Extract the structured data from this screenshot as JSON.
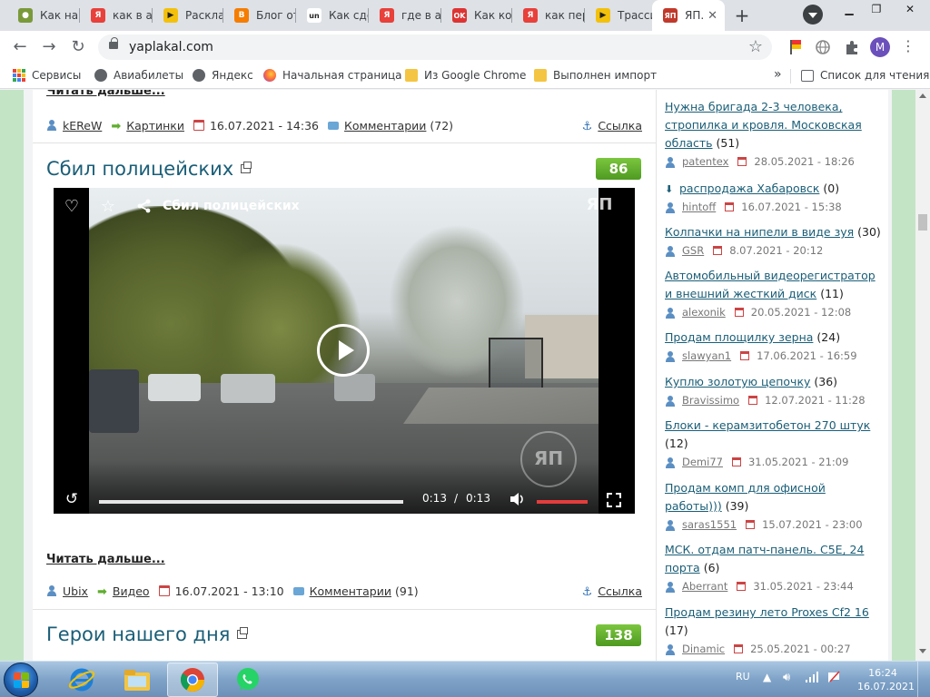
{
  "browser": {
    "tabs": [
      {
        "label": "Как на",
        "icon": "site-icon",
        "color": "#7a9a3a"
      },
      {
        "label": "как в а",
        "icon": "yandex-icon",
        "color": "#e8403a"
      },
      {
        "label": "Раскла",
        "icon": "play-icon",
        "color": "#f3c10c"
      },
      {
        "label": "Блог от",
        "icon": "blogger-icon",
        "color": "#f57d00"
      },
      {
        "label": "Как сде",
        "icon": "site-un-icon",
        "color": "#222222"
      },
      {
        "label": "где в а",
        "icon": "yandex-icon",
        "color": "#e8403a"
      },
      {
        "label": "Как ко",
        "icon": "ok-icon",
        "color": "#d33"
      },
      {
        "label": "как пер",
        "icon": "yandex-icon",
        "color": "#e8403a"
      },
      {
        "label": "Трасси",
        "icon": "play-icon",
        "color": "#f3c10c"
      },
      {
        "label": "ЯП.",
        "icon": "yaplakal-icon",
        "color": "#c0392b"
      }
    ],
    "url": "yaplakal.com",
    "avatar_letter": "M",
    "bookmarks": [
      {
        "label": "Сервисы",
        "icon": "apps-icon"
      },
      {
        "label": "Авиабилеты",
        "icon": "globe-icon"
      },
      {
        "label": "Яндекс",
        "icon": "globe-icon"
      },
      {
        "label": "Начальная страница",
        "icon": "firefox-icon"
      },
      {
        "label": "Из Google Chrome",
        "icon": "folder-icon"
      },
      {
        "label": "Выполнен импорт",
        "icon": "folder-icon"
      }
    ],
    "more_bookmarks": "»",
    "reading_list": "Список для чтения"
  },
  "posts": {
    "prev": {
      "read_more": "Читать дальше...",
      "author": "kEReW",
      "category": "Картинки",
      "date": "16.07.2021 - 14:36",
      "comments": "Комментарии",
      "comments_count": "(72)",
      "link": "Ссылка"
    },
    "main": {
      "title": "Сбил полицейских",
      "score": "86",
      "video": {
        "title": "Сбил полицейских",
        "logo": "ЯП",
        "current_time": "0:13",
        "separator": "/",
        "duration": "0:13",
        "progress": 1.0,
        "volume": 1.0
      },
      "read_more": "Читать дальше...",
      "author": "Ubix",
      "category": "Видео",
      "date": "16.07.2021 - 13:10",
      "comments": "Комментарии",
      "comments_count": "(91)",
      "link": "Ссылка"
    },
    "next": {
      "title": "Герои нашего дня",
      "score": "138"
    }
  },
  "sidebar": {
    "items": [
      {
        "title": "Нужна бригада 2-3 человека, стропилка и кровля. Московская область",
        "count": "(51)",
        "author": "patentex",
        "date": "28.05.2021 - 18:26",
        "hot": false
      },
      {
        "title": "распродажа Хабаровск",
        "count": "(0)",
        "author": "hintoff",
        "date": "16.07.2021 - 15:38",
        "hot": true
      },
      {
        "title": "Колпачки на нипели в виде зуя",
        "count": "(30)",
        "author": "GSR",
        "date": "8.07.2021 - 20:12",
        "hot": false
      },
      {
        "title": "Автомобильный видеорегистратор и внешний жесткий диск",
        "count": "(11)",
        "author": "alexonik",
        "date": "20.05.2021 - 12:08",
        "hot": false
      },
      {
        "title": "Продам площилку зерна",
        "count": "(24)",
        "author": "slawyan1",
        "date": "17.06.2021 - 16:59",
        "hot": false
      },
      {
        "title": "Куплю золотую цепочку",
        "count": "(36)",
        "author": "Bravissimo",
        "date": "12.07.2021 - 11:28",
        "hot": false
      },
      {
        "title": "Блоки - керамзитобетон 270 штук",
        "count": "(12)",
        "author": "Demi77",
        "date": "31.05.2021 - 21:09",
        "hot": false
      },
      {
        "title": "Продам комп для офисной работы)))",
        "count": "(39)",
        "author": "saras1551",
        "date": "15.07.2021 - 23:00",
        "hot": false
      },
      {
        "title": "МСК. отдам патч-панель. C5E, 24 порта",
        "count": "(6)",
        "author": "Aberrant",
        "date": "31.05.2021 - 23:44",
        "hot": false
      },
      {
        "title": "Продам резину лето Proxes Cf2 16",
        "count": "(17)",
        "author": "Dinamic",
        "date": "25.05.2021 - 00:27",
        "hot": false
      }
    ]
  },
  "taskbar": {
    "lang": "RU",
    "time": "16:24",
    "date": "16.07.2021"
  }
}
